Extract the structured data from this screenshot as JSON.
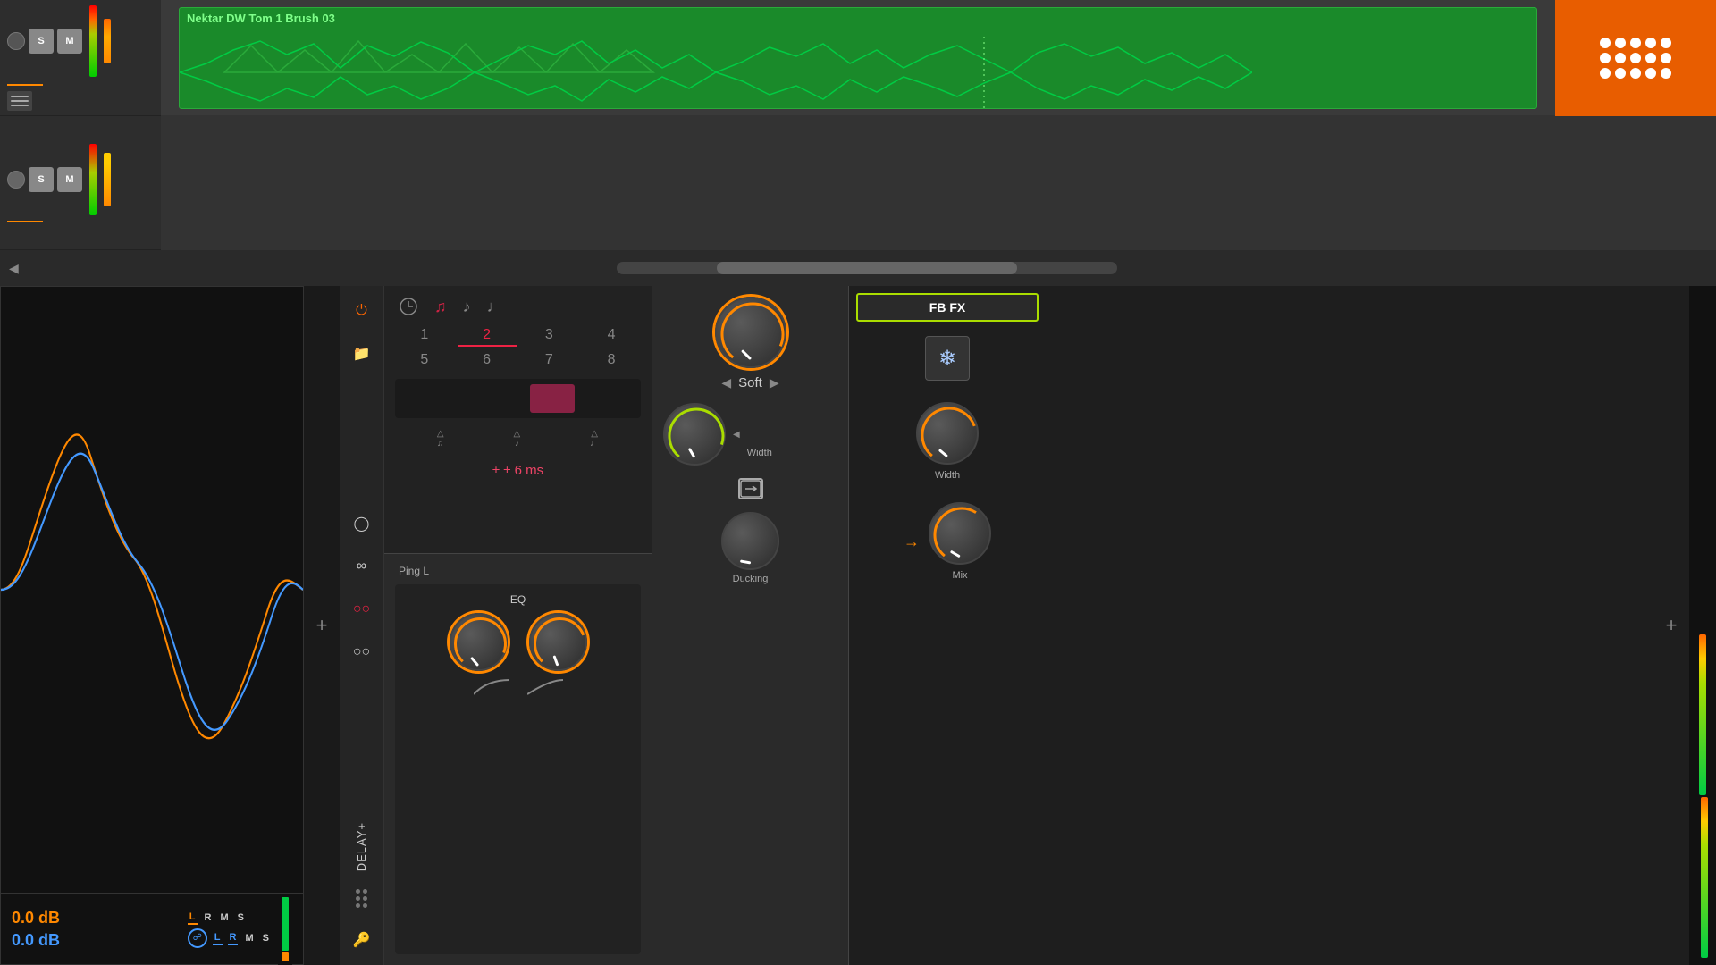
{
  "daw": {
    "track1": {
      "clip_title": "Nektar DW Tom 1 Brush 03",
      "s_label": "S",
      "m_label": "M"
    },
    "track2": {
      "s_label": "S",
      "m_label": "M"
    }
  },
  "analyzer": {
    "db_orange": "0.0 dB",
    "db_blue": "0.0 dB",
    "l_label": "L",
    "r_label": "R",
    "m_label": "M",
    "s_label": "S"
  },
  "delay_plugin": {
    "name": "DELAY+",
    "tab_label": "Ping L",
    "note_icons": [
      "♩",
      "♪",
      "♩",
      "♩"
    ],
    "numbers": [
      "1",
      "2",
      "3",
      "4",
      "5",
      "6",
      "7",
      "8"
    ],
    "active_number": "2",
    "delay_ms": "± 6 ms",
    "eq_label": "EQ",
    "soft_label": "Soft",
    "width_label": "Width",
    "ducking_label": "Ducking",
    "mix_label": "Mix",
    "fb_fx_label": "FB FX"
  }
}
